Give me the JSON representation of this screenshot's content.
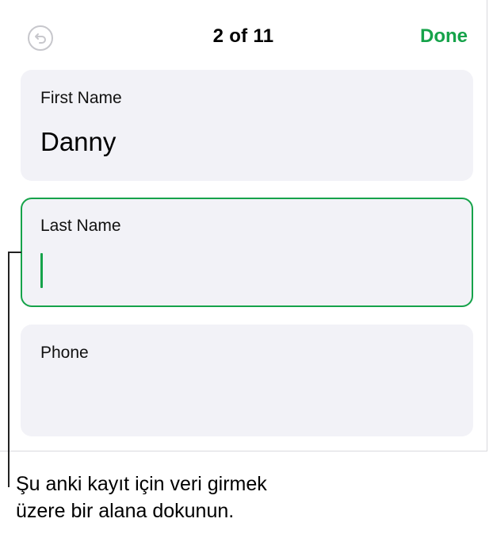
{
  "nav": {
    "counter": "2 of 11",
    "done_label": "Done",
    "undo_icon": "undo-arrow-icon"
  },
  "fields": [
    {
      "label": "First Name",
      "value": "Danny"
    },
    {
      "label": "Last Name",
      "value": ""
    },
    {
      "label": "Phone",
      "value": ""
    }
  ],
  "callout": {
    "text": "Şu anki kayıt için veri girmek\nüzere bir alana dokunun."
  },
  "colors": {
    "accent": "#16a34a",
    "field_background": "#f2f2f7",
    "disabled_icon": "#c7c7cc"
  }
}
